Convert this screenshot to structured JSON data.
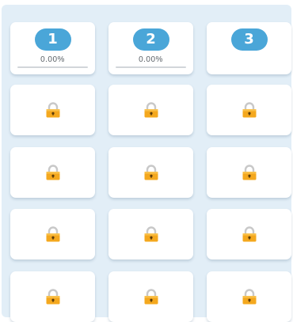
{
  "colors": {
    "background": "#e2eef7",
    "badge": "#4aa6d8",
    "lock_body": "#f4a81e",
    "lock_shackle": "#c8c8c8"
  },
  "levels": [
    {
      "number": "1",
      "progress": "0.00%",
      "progress_value": 0,
      "locked": false
    },
    {
      "number": "2",
      "progress": "0.00%",
      "progress_value": 0,
      "locked": false
    },
    {
      "number": "3",
      "locked": false
    },
    {
      "icon": "lock-icon",
      "locked": true
    },
    {
      "icon": "lock-icon",
      "locked": true
    },
    {
      "icon": "lock-icon",
      "locked": true
    },
    {
      "icon": "lock-icon",
      "locked": true
    },
    {
      "icon": "lock-icon",
      "locked": true
    },
    {
      "icon": "lock-icon",
      "locked": true
    },
    {
      "icon": "lock-icon",
      "locked": true
    },
    {
      "icon": "lock-icon",
      "locked": true
    },
    {
      "icon": "lock-icon",
      "locked": true
    },
    {
      "icon": "lock-icon",
      "locked": true
    },
    {
      "icon": "lock-icon",
      "locked": true
    },
    {
      "icon": "lock-icon",
      "locked": true
    }
  ]
}
